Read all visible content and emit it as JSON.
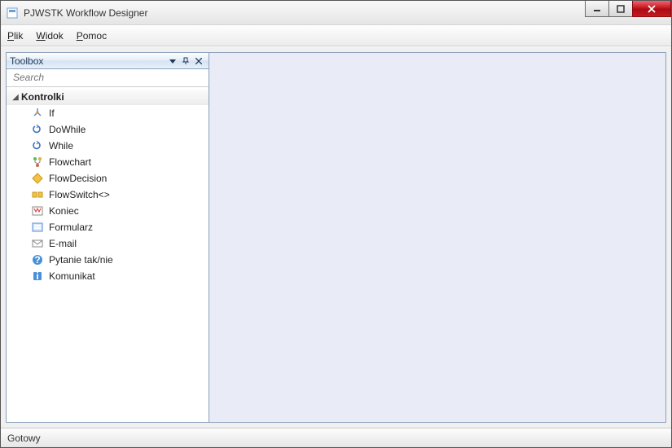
{
  "window": {
    "title": "PJWSTK Workflow Designer"
  },
  "menu": {
    "plik": {
      "label": "Plik",
      "accel_idx": 0
    },
    "widok": {
      "label": "Widok",
      "accel_idx": 0
    },
    "pomoc": {
      "label": "Pomoc",
      "accel_idx": 0
    }
  },
  "toolbox": {
    "title": "Toolbox",
    "search_placeholder": "Search",
    "category": "Kontrolki",
    "items": [
      {
        "label": "If",
        "icon": "if"
      },
      {
        "label": "DoWhile",
        "icon": "loop"
      },
      {
        "label": "While",
        "icon": "loop"
      },
      {
        "label": "Flowchart",
        "icon": "flowchart"
      },
      {
        "label": "FlowDecision",
        "icon": "decision"
      },
      {
        "label": "FlowSwitch<>",
        "icon": "switch"
      },
      {
        "label": "Koniec",
        "icon": "end"
      },
      {
        "label": "Formularz",
        "icon": "form"
      },
      {
        "label": "E-mail",
        "icon": "mail"
      },
      {
        "label": "Pytanie tak/nie",
        "icon": "question"
      },
      {
        "label": "Komunikat",
        "icon": "info"
      }
    ]
  },
  "status": {
    "text": "Gotowy"
  }
}
